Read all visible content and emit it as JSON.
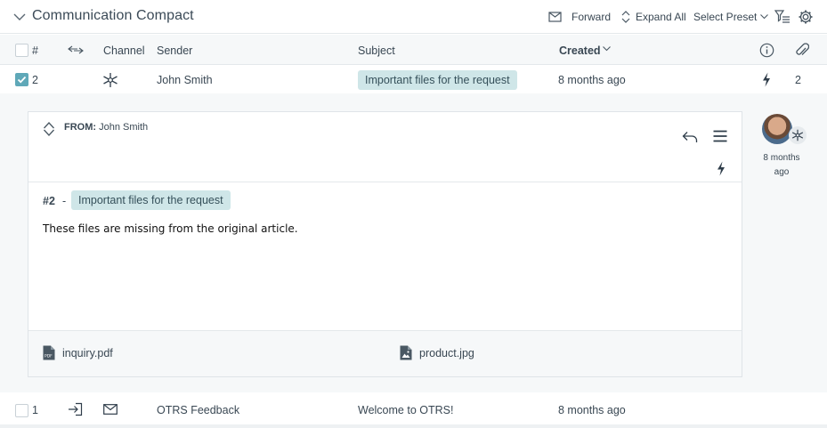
{
  "header": {
    "title": "Communication Compact",
    "forward_label": "Forward",
    "expand_all_label": "Expand All",
    "select_preset_label": "Select Preset"
  },
  "columns": {
    "number": "#",
    "channel": "Channel",
    "sender": "Sender",
    "subject": "Subject",
    "created": "Created"
  },
  "rows": [
    {
      "number": "2",
      "checked": true,
      "channel_icon": "internal-asterisk-icon",
      "sender": "John Smith",
      "subject": "Important files for the request",
      "created": "8 months ago",
      "attachment_count": "2"
    },
    {
      "number": "1",
      "checked": false,
      "direction_icon": "incoming-arrow-icon",
      "channel_icon": "email-icon",
      "sender": "OTRS Feedback",
      "subject": "Welcome to OTRS!",
      "created": "8 months ago"
    }
  ],
  "article": {
    "from_label": "FROM:",
    "from_name": "John Smith",
    "number": "#2",
    "separator": "-",
    "subject": "Important files for the request",
    "body": "These files are missing from the original article.",
    "attachments": [
      {
        "name": "inquiry.pdf",
        "icon": "pdf-file-icon"
      },
      {
        "name": "product.jpg",
        "icon": "image-file-icon"
      }
    ],
    "avatar_time": "8 months ago"
  },
  "colors": {
    "accent": "#5fa8b8",
    "tag_bg": "#cfe6e8",
    "row_bg": "#f6f8f9"
  }
}
